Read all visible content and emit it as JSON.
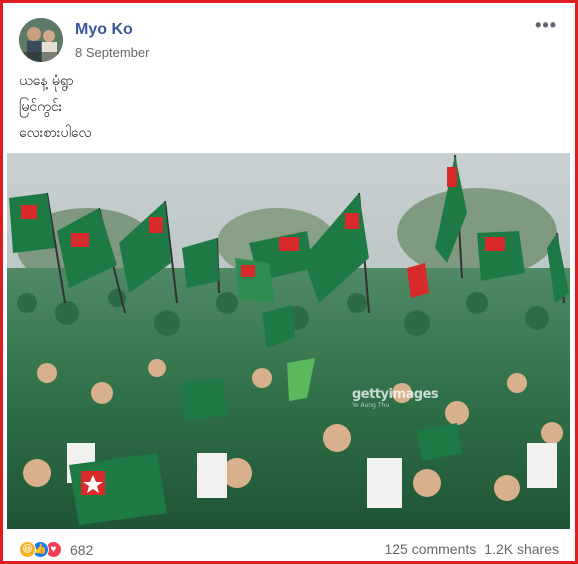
{
  "post": {
    "author": "Myo Ko",
    "date": "8 September",
    "menu_icon": "more-horizontal-icon",
    "text_lines": [
      "ယနေ့ မုံရွာ",
      "မြင်ကွင်း",
      "လေးစားပါလေ"
    ]
  },
  "image": {
    "watermark": "gettyimages",
    "watermark_credit": "Ye Aung Thu"
  },
  "footer": {
    "reactions": [
      "haha-icon",
      "like-icon",
      "love-icon"
    ],
    "reaction_count": "682",
    "comments": "125 comments",
    "shares": "1.2K shares"
  },
  "colors": {
    "frame_border": "#e11b22",
    "author_link": "#385898",
    "flag_green": "#1d7a45",
    "flag_red": "#d82a2a"
  }
}
